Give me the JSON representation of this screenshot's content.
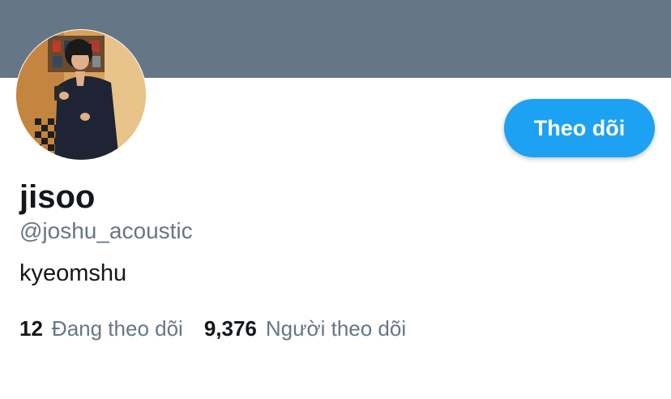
{
  "profile": {
    "display_name": "jisoo",
    "handle": "@joshu_acoustic",
    "bio": "kyeomshu",
    "follow_button_label": "Theo dõi",
    "avatar_icon": "profile-photo",
    "following": {
      "count": "12",
      "label": "Đang theo dõi"
    },
    "followers": {
      "count": "9,376",
      "label": "Người theo dõi"
    }
  },
  "colors": {
    "banner": "#657786",
    "accent": "#1da1f2",
    "text_primary": "#14171a",
    "text_secondary": "#657786"
  }
}
